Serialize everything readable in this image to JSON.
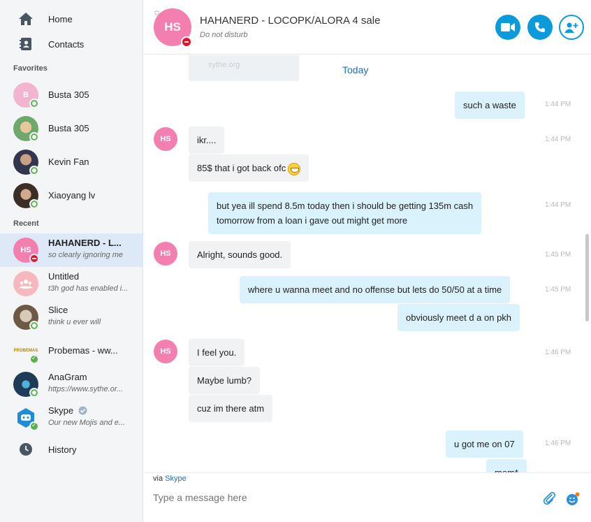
{
  "sidebar": {
    "nav": [
      {
        "label": "Home",
        "icon": "home-icon"
      },
      {
        "label": "Contacts",
        "icon": "contacts-icon"
      }
    ],
    "favorites_label": "Favorites",
    "favorites": [
      {
        "name": "Busta 305",
        "avatar_text": "B",
        "avatar_color": "#f3b4cf",
        "presence": "online"
      },
      {
        "name": "Busta 305",
        "avatar_text": "",
        "avatar_color": "#6ea86b",
        "presence": "online"
      },
      {
        "name": "Kevin Fan",
        "avatar_text": "",
        "avatar_color": "#4a4f6a",
        "presence": "online"
      },
      {
        "name": "Xiaoyang lv",
        "avatar_text": "",
        "avatar_color": "#6b5a4a",
        "presence": "online"
      }
    ],
    "recent_label": "Recent",
    "recent": [
      {
        "name": "HAHANERD - L...",
        "status": "so clearly ignoring me",
        "avatar_text": "HS",
        "avatar_color": "#f37fb0",
        "presence": "dnd",
        "active": true
      },
      {
        "name": "Untitled",
        "status": "t3h god has enabled i...",
        "avatar_text": "",
        "avatar_color": "#f6b7bd",
        "presence": "none"
      },
      {
        "name": "Slice",
        "status": "think u ever will",
        "avatar_text": "",
        "avatar_color": "#8a7a66",
        "presence": "online"
      },
      {
        "name": "Probemas - ww...",
        "status": "",
        "avatar_text": "PROBEMAS",
        "avatar_color": "#2a2a2a",
        "presence": "skype"
      },
      {
        "name": "AnaGram",
        "status": "https://www.sythe.or...",
        "avatar_text": "",
        "avatar_color": "#27496a",
        "presence": "online"
      },
      {
        "name": "Skype",
        "status": "Our new Mojis and e...",
        "avatar_text": "",
        "avatar_color": "#1f8dd6",
        "presence": "skype"
      }
    ],
    "history_label": "History"
  },
  "header": {
    "avatar_text": "HS",
    "title": "HAHANERD - LOCOPK/ALORA 4 sale",
    "status": "Do not disturb"
  },
  "chat": {
    "preview_text": "sythe.org",
    "date_separator": "Today",
    "messages": [
      {
        "dir": "out",
        "text": "such a waste",
        "time": "1:44 PM"
      },
      {
        "dir": "in",
        "text": "ikr....",
        "time": "1:44 PM"
      },
      {
        "dir": "in",
        "text": "85$ that i got back ofc",
        "time": ""
      },
      {
        "dir": "out",
        "text": "but yea ill spend 8.5m today then i should be getting 135m cash",
        "text2": "tomorrow from a loan i gave out might get more",
        "time": "1:44 PM"
      },
      {
        "dir": "in",
        "text": "Alright, sounds good.",
        "time": "1:45 PM"
      },
      {
        "dir": "out",
        "text": "where u wanna meet and no offense but lets do 50/50 at a time",
        "time": "1:45 PM"
      },
      {
        "dir": "out",
        "text": "obviously meet d a on pkh",
        "time": ""
      },
      {
        "dir": "in",
        "text": "I feel you.",
        "time": "1:46 PM"
      },
      {
        "dir": "in",
        "text": "Maybe lumb?",
        "time": ""
      },
      {
        "dir": "in",
        "text": "cuz im there atm",
        "time": ""
      },
      {
        "dir": "out",
        "text": "u got me on 07",
        "time": "1:46 PM"
      },
      {
        "dir": "out",
        "text": "mem*",
        "time": ""
      }
    ],
    "avatar_text": "HS"
  },
  "compose": {
    "via_prefix": "via",
    "via_service": "Skype",
    "placeholder": "Type a message here"
  }
}
